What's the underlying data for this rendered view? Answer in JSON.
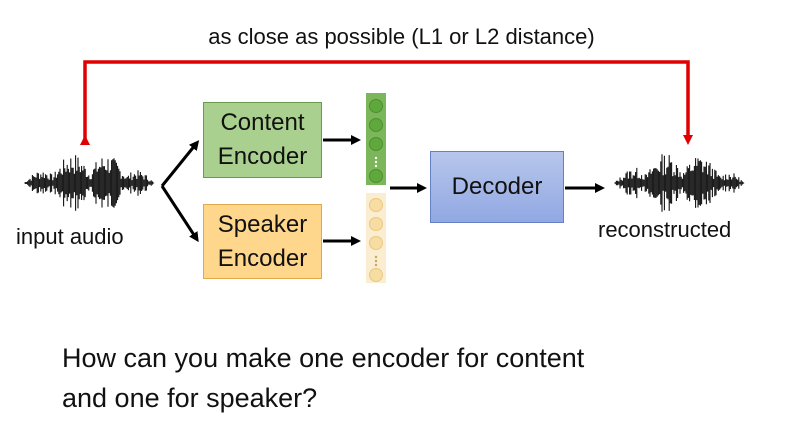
{
  "top_label": "as close as possible (L1 or L2 distance)",
  "input_label": "input audio",
  "reconstructed_label": "reconstructed",
  "content_encoder": "Content\nEncoder",
  "speaker_encoder": "Speaker\nEncoder",
  "decoder": "Decoder",
  "question": "How can you make one encoder for content\nand one for speaker?",
  "colors": {
    "feedback_arrow": "#e00000",
    "content_box": "#a9d08e",
    "speaker_box": "#ffd78c",
    "decoder_box": "#91a8e2",
    "content_vector": "#7bb75a",
    "speaker_vector": "#f9dfa8"
  }
}
